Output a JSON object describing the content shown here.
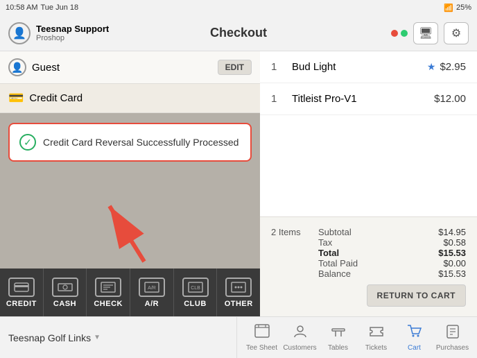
{
  "statusBar": {
    "time": "10:58 AM",
    "day": "Tue Jun 18",
    "battery": "25%"
  },
  "header": {
    "profileName": "Teesnap Support",
    "profileShop": "Proshop",
    "title": "Checkout"
  },
  "leftPanel": {
    "guestLabel": "Guest",
    "editLabel": "EDIT",
    "creditCardLabel": "Credit Card",
    "successMessage": "Credit Card Reversal Successfully Processed"
  },
  "paymentButtons": [
    {
      "id": "credit",
      "label": "CREDIT",
      "icon": "💳"
    },
    {
      "id": "cash",
      "label": "CASH",
      "icon": "💵"
    },
    {
      "id": "check",
      "label": "CHECK",
      "icon": "📋"
    },
    {
      "id": "ar",
      "label": "A/R",
      "icon": "📄"
    },
    {
      "id": "club",
      "label": "CLUB",
      "icon": "⛳"
    },
    {
      "id": "other",
      "label": "OTHER",
      "icon": "🔄"
    }
  ],
  "orderItems": [
    {
      "qty": "1",
      "name": "Bud Light",
      "price": "$2.95",
      "starred": true
    },
    {
      "qty": "1",
      "name": "Titleist Pro-V1",
      "price": "$12.00",
      "starred": false
    }
  ],
  "summary": {
    "itemCount": "2 Items",
    "subtotalLabel": "Subtotal",
    "subtotalValue": "$14.95",
    "taxLabel": "Tax",
    "taxValue": "$0.58",
    "totalLabel": "Total",
    "totalValue": "$15.53",
    "totalPaidLabel": "Total Paid",
    "totalPaidValue": "$0.00",
    "balanceLabel": "Balance",
    "balanceValue": "$15.53",
    "returnToCart": "RETURN TO CART"
  },
  "bottomNav": {
    "venueName": "Teesnap Golf Links",
    "items": [
      {
        "id": "tee-sheet",
        "label": "Tee Sheet",
        "active": false
      },
      {
        "id": "customers",
        "label": "Customers",
        "active": false
      },
      {
        "id": "tables",
        "label": "Tables",
        "active": false
      },
      {
        "id": "tickets",
        "label": "Tickets",
        "active": false
      },
      {
        "id": "cart",
        "label": "Cart",
        "active": true
      },
      {
        "id": "purchases",
        "label": "Purchases",
        "active": false
      }
    ]
  }
}
